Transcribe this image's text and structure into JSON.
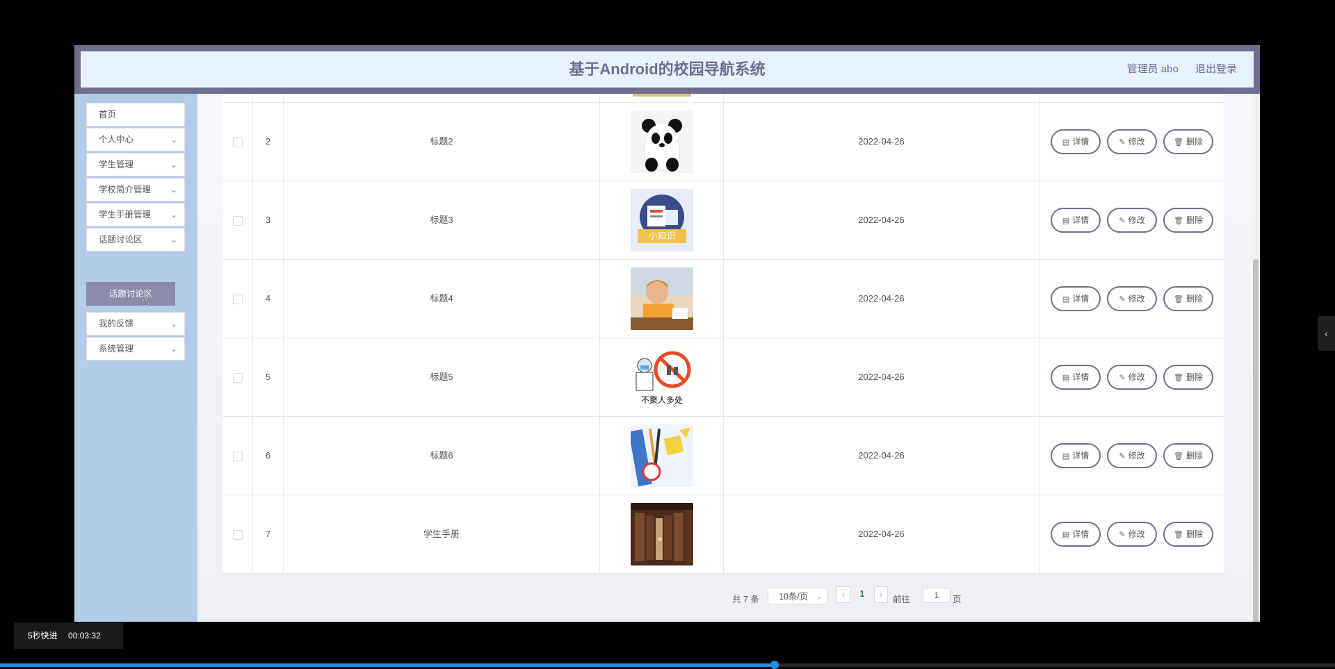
{
  "header": {
    "title": "基于Android的校园导航系统",
    "admin_label": "管理员 abo",
    "logout_label": "退出登录"
  },
  "sidebar": {
    "items": [
      {
        "label": "首页"
      },
      {
        "label": "个人中心"
      },
      {
        "label": "学生管理"
      },
      {
        "label": "学校简介管理"
      },
      {
        "label": "学生手册管理"
      },
      {
        "label": "话题讨论区"
      },
      {
        "label": "我的反馈"
      },
      {
        "label": "系统管理"
      }
    ],
    "active_subitem": "话题讨论区",
    "chevron_icon": "chevron-down-icon"
  },
  "table": {
    "rows": [
      {
        "index": "2",
        "title": "标题2",
        "image": "panda-image",
        "date": "2022-04-26"
      },
      {
        "index": "3",
        "title": "标题3",
        "image": "knowledge-image",
        "date": "2022-04-26"
      },
      {
        "index": "4",
        "title": "标题4",
        "image": "student-image",
        "date": "2022-04-26"
      },
      {
        "index": "5",
        "title": "标题5",
        "image": "no-gathering-image",
        "date": "2022-04-26"
      },
      {
        "index": "6",
        "title": "标题6",
        "image": "stationery-image",
        "date": "2022-04-26"
      },
      {
        "index": "7",
        "title": "学生手册",
        "image": "library-image",
        "date": "2022-04-26"
      }
    ],
    "actions": {
      "detail": "详情",
      "edit": "修改",
      "delete": "删除"
    }
  },
  "pagination": {
    "total": "共 7 条",
    "page_size": "10条/页",
    "current_page": "1",
    "goto_label": "前往",
    "goto_value": "1",
    "page_suffix": "页"
  },
  "player": {
    "skip_label": "5秒快进",
    "timestamp": "00:03:32",
    "progress_fraction": 0.58
  },
  "colors": {
    "accent": "#6f6e8f",
    "sidebar_bg": "#b3cce9",
    "header_bg": "#e6f2fc"
  }
}
